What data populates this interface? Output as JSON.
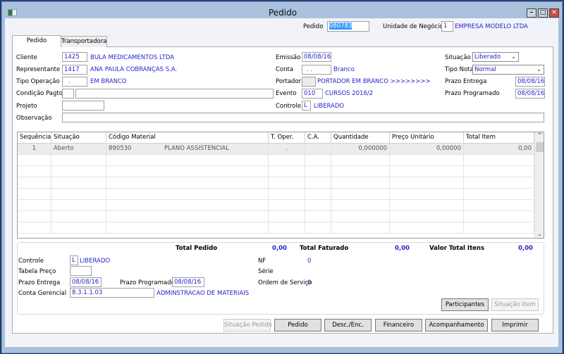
{
  "window": {
    "title": "Pedido"
  },
  "header": {
    "pedido_label": "Pedido",
    "pedido_value": "080783",
    "unidade_label": "Unidade de Negócio",
    "unidade_code": "1",
    "unidade_name": "EMPRESA MODELO LTDA"
  },
  "tabs": [
    {
      "label": "Pedido",
      "active": true
    },
    {
      "label": "Transportadora",
      "active": false
    }
  ],
  "form": {
    "cliente": {
      "label": "Cliente",
      "code": "1425",
      "name": "BULA MEDICAMENTOS LTDA"
    },
    "representante": {
      "label": "Representante",
      "code": "1417",
      "name": "ANA PAULA COBRANÇAS S.A."
    },
    "tipo_operacao": {
      "label": "Tipo Operação",
      "code": ".",
      "name": "EM BRANCO"
    },
    "condicao_pagto": {
      "label": "Condição Pagto.",
      "code": "",
      "name": ""
    },
    "projeto": {
      "label": "Projeto",
      "value": ""
    },
    "observacao": {
      "label": "Observação",
      "value": ""
    },
    "emissao": {
      "label": "Emissão",
      "value": "08/08/16"
    },
    "conta": {
      "label": "Conta",
      "code": ". .",
      "name": "Branco"
    },
    "portador": {
      "label": "Portador",
      "code": "",
      "name": "PORTADOR EM BRANCO >>>>>>>>"
    },
    "evento": {
      "label": "Evento",
      "code": "010",
      "name": "CURSOS 2016/2"
    },
    "controle": {
      "label": "Controle",
      "code": "L",
      "name": "LIBERADO"
    },
    "situacao": {
      "label": "Situação",
      "value": "Liberado"
    },
    "tipo_nota": {
      "label": "Tipo Nota",
      "value": "Normal"
    },
    "prazo_entrega": {
      "label": "Prazo Entrega",
      "value": "08/08/16"
    },
    "prazo_programado": {
      "label": "Prazo Programado",
      "value": "08/08/16"
    }
  },
  "grid": {
    "columns": [
      "Sequência",
      "Situação",
      "Código Material",
      "T. Oper.",
      "C.A.",
      "Quantidade",
      "Preço Unitário",
      "Total Item"
    ],
    "rows": [
      {
        "seq": "1",
        "situacao": "Aberto",
        "codigo": "890530",
        "descricao": "PLANO ASSISTENCIAL",
        "t_oper": ".",
        "ca": "",
        "quantidade": "0,000000",
        "preco": "0,00000",
        "total": "0,00"
      }
    ]
  },
  "totals": {
    "total_pedido_label": "Total Pedido",
    "total_pedido": "0,00",
    "total_faturado_label": "Total Faturado",
    "total_faturado": "0,00",
    "valor_total_itens_label": "Valor Total Itens",
    "valor_total_itens": "0,00"
  },
  "bottom": {
    "controle": {
      "label": "Controle",
      "code": "L",
      "name": "LIBERADO"
    },
    "tabela_preco": {
      "label": "Tabela Preço",
      "value": ""
    },
    "prazo_entrega": {
      "label": "Prazo Entrega",
      "value": "08/08/16"
    },
    "prazo_programado": {
      "label": "Prazo Programado",
      "value": "08/08/16"
    },
    "conta_gerencial": {
      "label": "Conta Gerencial",
      "code": "8.3.1.1.03",
      "name": "ADMINSTRACAO DE MATERIAIS"
    },
    "nf": {
      "label": "NF",
      "value": "0"
    },
    "serie": {
      "label": "Série",
      "value": ""
    },
    "ordem_servico": {
      "label": "Ordem de Serviço",
      "value": "0"
    }
  },
  "buttons": {
    "participantes": "Participantes",
    "situacao_item": "Situação Item",
    "situacao_pedido": "Situação Pedido",
    "pedido": "Pedido",
    "desc_enc": "Desc./Enc.",
    "financeiro": "Financeiro",
    "acompanhamento": "Acompanhamento",
    "imprimir": "Imprimir"
  },
  "colors": {
    "titlebar": "#a9c1dc",
    "value_text": "#2424c8",
    "close_button": "#c7503e"
  }
}
